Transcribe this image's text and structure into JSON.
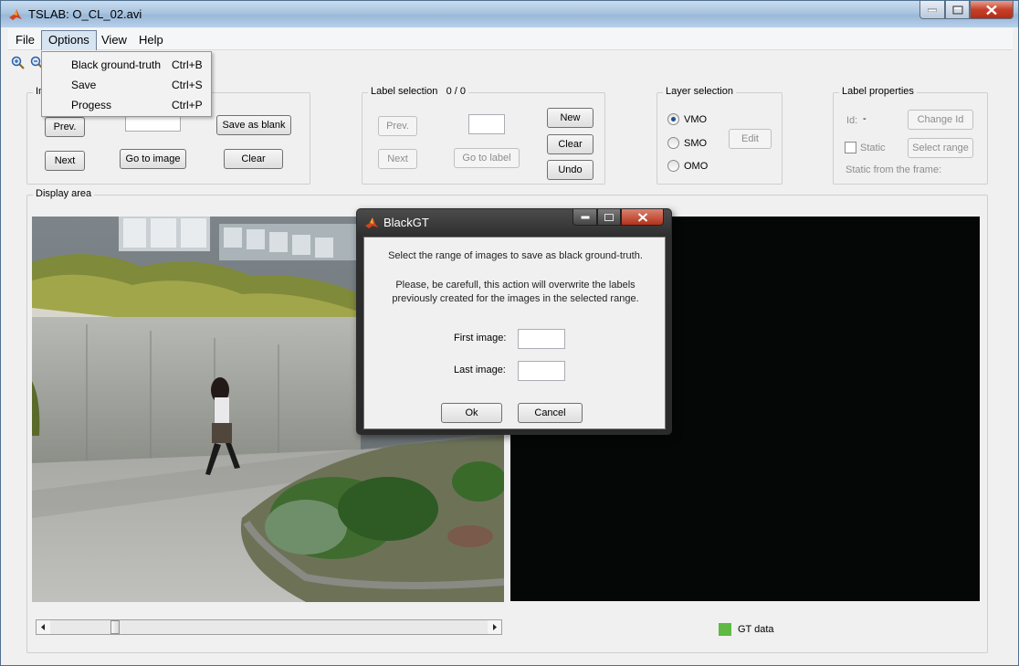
{
  "window": {
    "title": "TSLAB: O_CL_02.avi"
  },
  "menubar": {
    "items": [
      "File",
      "Options",
      "View",
      "Help"
    ]
  },
  "options_menu": {
    "items": [
      {
        "label": "Black ground-truth",
        "shortcut": "Ctrl+B"
      },
      {
        "label": "Save",
        "shortcut": "Ctrl+S"
      },
      {
        "label": "Progess",
        "shortcut": "Ctrl+P"
      }
    ]
  },
  "image_panel": {
    "title": "Im",
    "prev": "Prev.",
    "next": "Next",
    "go_to_image": "Go to image",
    "save_as_blank": "Save as blank",
    "clear": "Clear",
    "image_number_value": ""
  },
  "label_selection": {
    "title": "Label selection",
    "count": "0 / 0",
    "prev": "Prev.",
    "next": "Next",
    "go_to_label": "Go to label",
    "new": "New",
    "clear": "Clear",
    "undo": "Undo",
    "label_number_value": ""
  },
  "layer_selection": {
    "title": "Layer selection",
    "options": [
      "VMO",
      "SMO",
      "OMO"
    ],
    "selected": "VMO",
    "edit": "Edit"
  },
  "label_properties": {
    "title": "Label properties",
    "id_label": "Id:",
    "id_value": "-",
    "change_id": "Change Id",
    "static_label": "Static",
    "select_range": "Select range",
    "static_from": "Static from the frame:"
  },
  "display_area": {
    "title": "Display area"
  },
  "legend": {
    "gt_data": "GT data",
    "gt_color": "#5fb944"
  },
  "dialog": {
    "title": "BlackGT",
    "line1": "Select the range of images to save as black ground-truth.",
    "line2": "Please, be carefull, this action will overwrite the labels",
    "line3": "previously created for the images in the selected range.",
    "first_image_label": "First image:",
    "last_image_label": "Last image:",
    "first_image_value": "",
    "last_image_value": "",
    "ok": "Ok",
    "cancel": "Cancel"
  },
  "slider": {
    "position": 0.14
  }
}
